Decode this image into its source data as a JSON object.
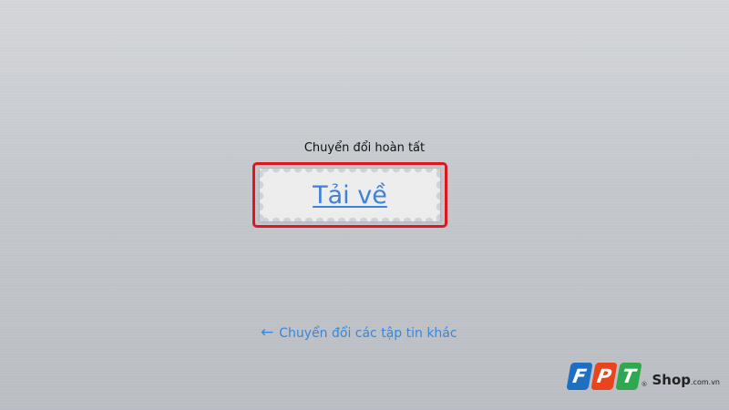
{
  "status": {
    "message": "Chuyển đổi hoàn tất"
  },
  "download": {
    "label": "Tải về"
  },
  "back_link": {
    "label": "Chuyển đổi các tập tin khác",
    "icon": "arrow-left-icon"
  },
  "watermark": {
    "letters": [
      "F",
      "P",
      "T"
    ],
    "registered": "®",
    "word": "Shop",
    "domain": ".com.vn",
    "colors": [
      "#1e6fbf",
      "#e8441d",
      "#2fa84f"
    ]
  }
}
